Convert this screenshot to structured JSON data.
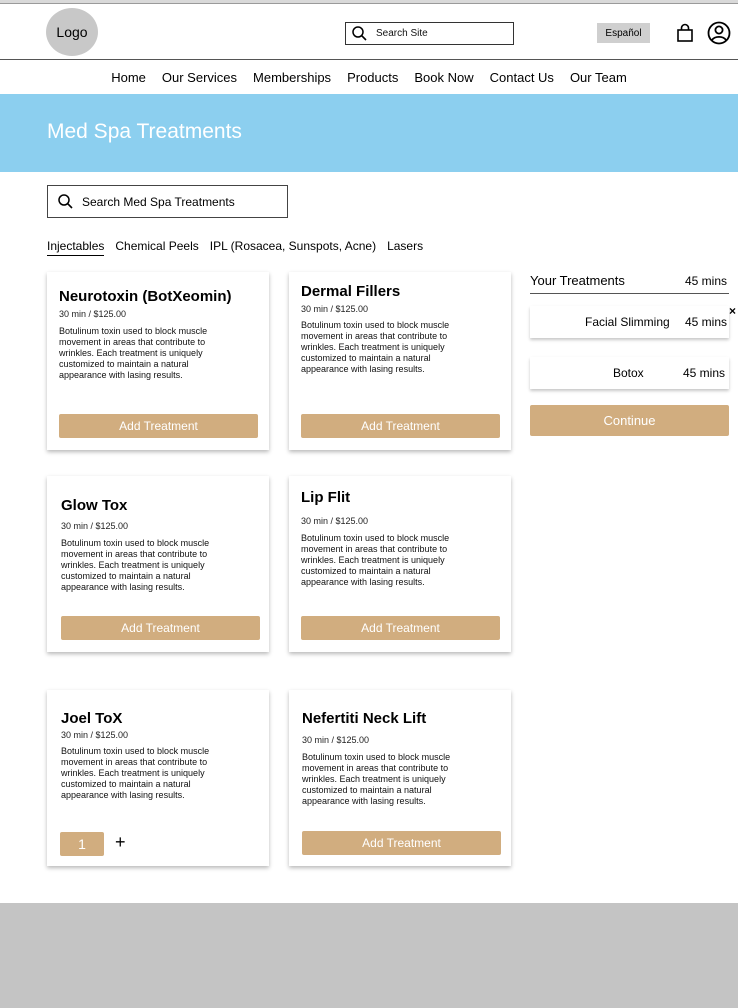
{
  "header": {
    "logo": "Logo",
    "search_placeholder": "Search Site",
    "language": "Español",
    "icons": [
      "search-icon",
      "shopping-bag-icon",
      "account-icon"
    ]
  },
  "nav": [
    "Home",
    "Our Services",
    "Memberships",
    "Products",
    "Book Now",
    "Contact Us",
    "Our Team"
  ],
  "hero": {
    "title": "Med Spa Treatments"
  },
  "treatment_search": {
    "placeholder": "Search Med Spa Treatments"
  },
  "tabs": [
    "Injectables",
    "Chemical Peels",
    "IPL (Rosacea, Sunspots, Acne)",
    "Lasers"
  ],
  "cards": [
    {
      "title": "Neurotoxin (BotXeomin)",
      "meta": "30 min / $125.00",
      "desc": "Botulinum toxin used to block muscle movement in areas that contribute to wrinkles. Each treatment is uniquely customized to maintain a natural appearance with lasing results.",
      "button": "Add Treatment"
    },
    {
      "title": "Dermal Fillers",
      "meta": "30 min / $125.00",
      "desc": "Botulinum toxin used to block muscle movement in areas that contribute to wrinkles. Each treatment is uniquely customized to maintain a natural appearance with lasing results.",
      "button": "Add Treatment"
    },
    {
      "title": "Glow Tox",
      "meta": "30 min / $125.00",
      "desc": "Botulinum toxin used to block muscle movement in areas that contribute to wrinkles. Each treatment is uniquely customized to maintain a natural appearance with lasing results.",
      "button": "Add Treatment"
    },
    {
      "title": "Lip Flit",
      "meta": "30 min / $125.00",
      "desc": "Botulinum toxin used to block muscle movement in areas that contribute to wrinkles. Each treatment is uniquely customized to maintain a natural appearance with lasing results.",
      "button": "Add Treatment"
    },
    {
      "title": "Joel ToX",
      "meta": "30 min / $125.00",
      "desc": "Botulinum toxin used to block muscle movement in areas that contribute to wrinkles. Each treatment is uniquely customized to maintain a natural appearance with lasing results.",
      "quantity": "1",
      "plus": "+"
    },
    {
      "title": "Nefertiti Neck Lift",
      "meta": "30 min / $125.00",
      "desc": "Botulinum toxin used to block muscle movement in areas that contribute to wrinkles. Each treatment is uniquely customized to maintain a natural appearance with lasing results.",
      "button": "Add Treatment"
    }
  ],
  "sidebar": {
    "title": "Your Treatments",
    "total": "45 mins",
    "items": [
      {
        "name": "Facial Slimming",
        "time": "45 mins"
      },
      {
        "name": "Botox",
        "time": "45 mins"
      }
    ],
    "remove": "×",
    "continue": "Continue"
  },
  "colors": {
    "hero": "#8ccfef",
    "accent": "#d1ad7f",
    "footer": "#c4c4c4"
  }
}
